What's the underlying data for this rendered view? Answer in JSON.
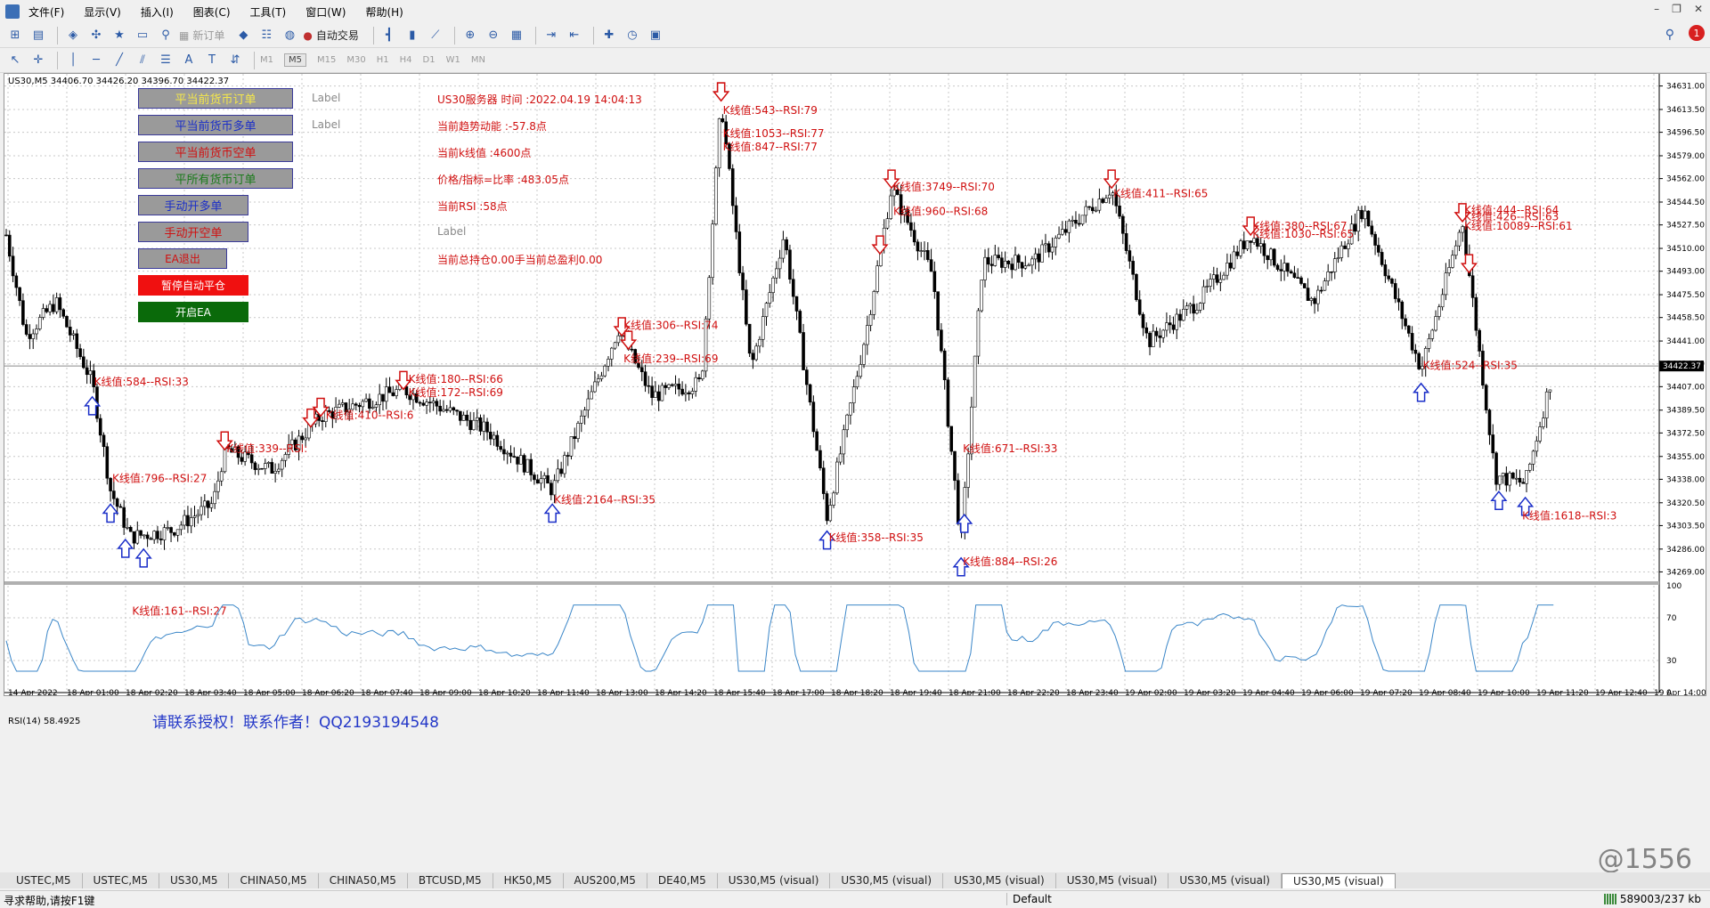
{
  "menubar": {
    "items": [
      "文件(F)",
      "显示(V)",
      "插入(I)",
      "图表(C)",
      "工具(T)",
      "窗口(W)",
      "帮助(H)"
    ]
  },
  "toolbar": {
    "new_order": "新订单",
    "auto_trade": "自动交易",
    "timeframes": [
      "M1",
      "M5",
      "M15",
      "M30",
      "H1",
      "H4",
      "D1",
      "W1",
      "MN"
    ],
    "active_timeframe": "M5",
    "alert_count": "1"
  },
  "chart": {
    "symbol_info": "US30,M5  34406.70 34426.20 34396.70 34422.37",
    "rsi_info": "RSI(14) 58.4925",
    "current_price": "34422.37",
    "price_ticks": [
      "34631.00",
      "34613.50",
      "34596.50",
      "34579.00",
      "34562.00",
      "34544.50",
      "34527.50",
      "34510.00",
      "34493.00",
      "34475.50",
      "34458.50",
      "34441.00",
      "34424.00",
      "34407.00",
      "34389.50",
      "34372.50",
      "34355.00",
      "34338.00",
      "34320.50",
      "34303.50",
      "34286.00",
      "34269.00"
    ],
    "rsi_ticks": [
      "100",
      "70",
      "30",
      "0"
    ],
    "time_ticks": [
      "14 Apr 2022",
      "18 Apr 01:00",
      "18 Apr 02:20",
      "18 Apr 03:40",
      "18 Apr 05:00",
      "18 Apr 06:20",
      "18 Apr 07:40",
      "18 Apr 09:00",
      "18 Apr 10:20",
      "18 Apr 11:40",
      "18 Apr 13:00",
      "18 Apr 14:20",
      "18 Apr 15:40",
      "18 Apr 17:00",
      "18 Apr 18:20",
      "18 Apr 19:40",
      "18 Apr 21:00",
      "18 Apr 22:20",
      "18 Apr 23:40",
      "19 Apr 02:00",
      "19 Apr 03:20",
      "19 Apr 04:40",
      "19 Apr 06:00",
      "19 Apr 07:20",
      "19 Apr 08:40",
      "19 Apr 10:00",
      "19 Apr 11:20",
      "19 Apr 12:40",
      "19 Apr 14:00"
    ],
    "colors": {
      "candle": "#000000",
      "rsi_line": "#3a86c8",
      "signal_text": "#d01010",
      "buy_arrow": "#1a2ec8",
      "sell_arrow": "#d01010",
      "grid": "#c8c8c8"
    },
    "annotations": [
      {
        "text": "K线值:543--RSI:79",
        "price": 34610,
        "t": 0.432
      },
      {
        "text": "K线值:1053--RSI:77",
        "price": 34593,
        "t": 0.432
      },
      {
        "text": "K线值:847--RSI:77",
        "price": 34583,
        "t": 0.432
      },
      {
        "text": "K线值:3749--RSI:70",
        "price": 34553,
        "t": 0.535
      },
      {
        "text": "K线值:960--RSI:68",
        "price": 34535,
        "t": 0.535
      },
      {
        "text": "K线值:411--RSI:65",
        "price": 34548,
        "t": 0.668
      },
      {
        "text": "K线值:380--RSI:67",
        "price": 34524,
        "t": 0.752
      },
      {
        "text": "K线值:1030--RSI:65",
        "price": 34518,
        "t": 0.752
      },
      {
        "text": "K线值:444--RSI:64",
        "price": 34536,
        "t": 0.88
      },
      {
        "text": "K线值:426--RSI:63",
        "price": 34531,
        "t": 0.88
      },
      {
        "text": "K线值:10089--RSI:61",
        "price": 34524,
        "t": 0.88
      },
      {
        "text": "K线值:306--RSI:74",
        "price": 34450,
        "t": 0.372
      },
      {
        "text": "K线值:239--RSI:69",
        "price": 34425,
        "t": 0.372
      },
      {
        "text": "K线值:584--RSI:33",
        "price": 34408,
        "t": 0.052
      },
      {
        "text": "K线值:524--RSI:35",
        "price": 34420,
        "t": 0.855
      },
      {
        "text": "K线值:180--RSI:66",
        "price": 34410,
        "t": 0.242
      },
      {
        "text": "K线值:172--RSI:69",
        "price": 34400,
        "t": 0.242
      },
      {
        "text": "K线值:410--RSI:6",
        "price": 34383,
        "t": 0.192
      },
      {
        "text": "K线值:339--RSI:",
        "price": 34358,
        "t": 0.132
      },
      {
        "text": "K线值:796--RSI:27",
        "price": 34336,
        "t": 0.063
      },
      {
        "text": "K线值:2164--RSI:35",
        "price": 34320,
        "t": 0.33
      },
      {
        "text": "K线值:671--RSI:33",
        "price": 34358,
        "t": 0.577
      },
      {
        "text": "K线值:358--RSI:35",
        "price": 34292,
        "t": 0.496
      },
      {
        "text": "K线值:884--RSI:26",
        "price": 34274,
        "t": 0.577
      },
      {
        "text": "K线值:161--RSI:27",
        "price": 34237,
        "t": 0.075
      },
      {
        "text": "K线值:1618--RSI:3",
        "price": 34308,
        "t": 0.915
      }
    ],
    "buy_arrows": [
      0.052,
      0.063,
      0.072,
      0.083,
      0.33,
      0.496,
      0.577,
      0.579,
      0.855,
      0.902,
      0.918
    ],
    "sell_arrows": [
      0.132,
      0.184,
      0.19,
      0.24,
      0.372,
      0.376,
      0.432,
      0.432,
      0.528,
      0.535,
      0.668,
      0.752,
      0.88,
      0.884
    ]
  },
  "ea_panel": {
    "close_current": "平当前货币订单",
    "close_current_buy": "平当前货币多单",
    "close_current_sell": "平当前货币空单",
    "close_all": "平所有货币订单",
    "manual_buy": "手动开多单",
    "manual_sell": "手动开空单",
    "ea_exit": "EA退出",
    "pause_auto_close": "暂停自动平仓",
    "start_ea": "开启EA",
    "label1": "Label",
    "label2": "Label",
    "label3": "Label"
  },
  "info": {
    "server_time": "US30服务器  时间 :2022.04.19 14:04:13",
    "trend": "当前趋势动能 :-57.8点",
    "k_value": "当前k线值 :4600点",
    "ratio": "价格/指标=比率 :483.05点",
    "rsi": "当前RSI :58点",
    "position": "当前总持仓0.00手当前总盈利0.00",
    "watermark": "请联系授权！联系作者！QQ2193194548"
  },
  "tabs": [
    "USTEC,M5",
    "USTEC,M5",
    "US30,M5",
    "CHINA50,M5",
    "CHINA50,M5",
    "BTCUSD,M5",
    "HK50,M5",
    "AUS200,M5",
    "DE40,M5",
    "US30,M5 (visual)",
    "US30,M5 (visual)",
    "US30,M5 (visual)",
    "US30,M5 (visual)",
    "US30,M5 (visual)",
    "US30,M5 (visual)"
  ],
  "active_tab_index": 14,
  "status": {
    "help": "寻求帮助,请按F1键",
    "profile": "Default",
    "traffic": "589003/237 kb"
  },
  "corner_watermark": "@1556"
}
